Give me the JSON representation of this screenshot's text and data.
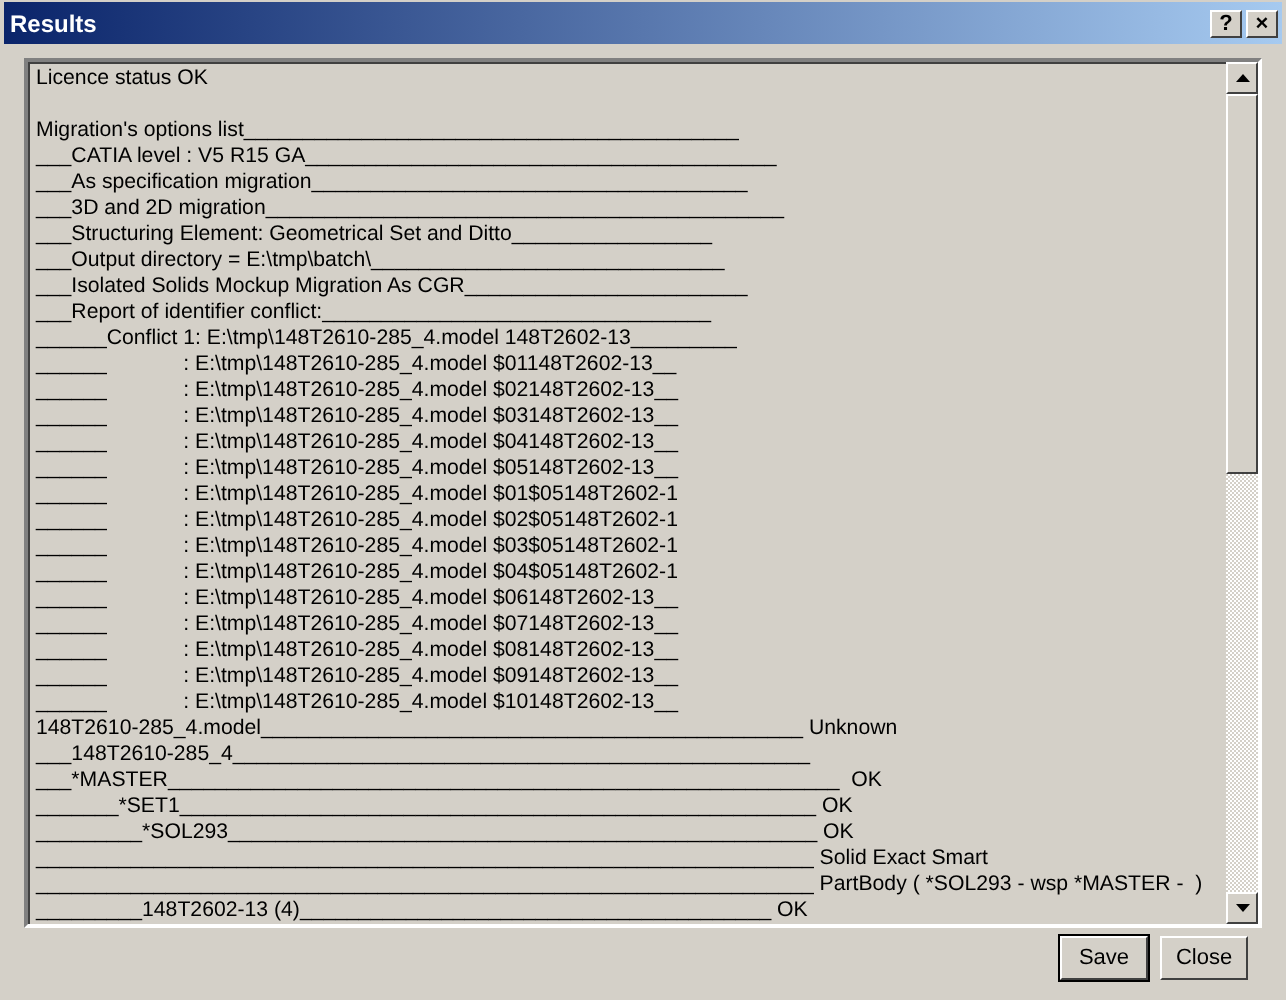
{
  "window": {
    "title": "Results",
    "controls": [
      "?",
      "×"
    ]
  },
  "log": {
    "status": "Licence status OK",
    "lines": [
      "Migration's options list__________________________________________",
      "___CATIA level : V5 R15 GA________________________________________",
      "___As specification migration_____________________________________",
      "___3D and 2D migration____________________________________________",
      "___Structuring Element: Geometrical Set and Ditto_________________",
      "___Output directory = E:\\tmp\\batch\\______________________________",
      "___Isolated Solids Mockup Migration As CGR________________________",
      "___Report of identifier conflict:_________________________________",
      "______Conflict 1: E:\\tmp\\148T2610-285_4.model 148T2602-13_________",
      "______             : E:\\tmp\\148T2610-285_4.model $01148T2602-13__",
      "______             : E:\\tmp\\148T2610-285_4.model $02148T2602-13__",
      "______             : E:\\tmp\\148T2610-285_4.model $03148T2602-13__",
      "______             : E:\\tmp\\148T2610-285_4.model $04148T2602-13__",
      "______             : E:\\tmp\\148T2610-285_4.model $05148T2602-13__",
      "______             : E:\\tmp\\148T2610-285_4.model $01$05148T2602-1",
      "______             : E:\\tmp\\148T2610-285_4.model $02$05148T2602-1",
      "______             : E:\\tmp\\148T2610-285_4.model $03$05148T2602-1",
      "______             : E:\\tmp\\148T2610-285_4.model $04$05148T2602-1",
      "______             : E:\\tmp\\148T2610-285_4.model $06148T2602-13__",
      "______             : E:\\tmp\\148T2610-285_4.model $07148T2602-13__",
      "______             : E:\\tmp\\148T2610-285_4.model $08148T2602-13__",
      "______             : E:\\tmp\\148T2610-285_4.model $09148T2602-13__",
      "______             : E:\\tmp\\148T2610-285_4.model $10148T2602-13__",
      "148T2610-285_4.model______________________________________________ Unknown",
      "___148T2610-285_4_________________________________________________",
      "___*MASTER_________________________________________________________  OK",
      "_______*SET1______________________________________________________ OK",
      "_________*SOL293__________________________________________________ OK",
      "__________________________________________________________________ Solid Exact Smart",
      "__________________________________________________________________ PartBody ( *SOL293 - wsp *MASTER -  )",
      "_________148T2602-13 (4)________________________________________ OK"
    ]
  },
  "buttons": [
    "Save",
    "Close"
  ]
}
